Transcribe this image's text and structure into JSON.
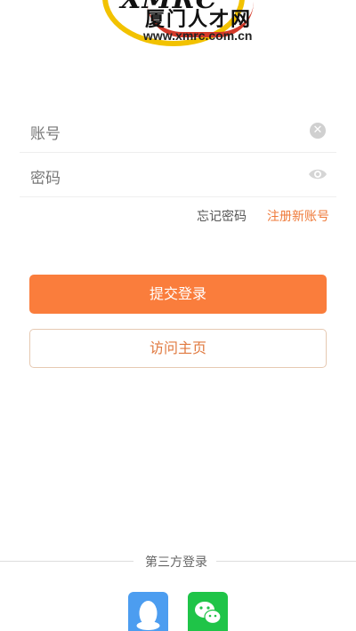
{
  "logo": {
    "brand": "XMRC",
    "name": "厦门人才网",
    "url": "www.xmrc.com.cn"
  },
  "form": {
    "account_label": "账号",
    "password_label": "密码",
    "account_value": "",
    "password_value": ""
  },
  "links": {
    "forgot_password": "忘记密码",
    "register": "注册新账号"
  },
  "buttons": {
    "login": "提交登录",
    "visit_home": "访问主页"
  },
  "third_party": {
    "label": "第三方登录",
    "providers": [
      {
        "name": "QQ",
        "icon": "qq-icon",
        "color": "#4c9df0"
      },
      {
        "name": "WeChat",
        "icon": "wechat-icon",
        "color": "#1fc448"
      }
    ]
  },
  "colors": {
    "accent": "#fa7d3c",
    "link_accent": "#ef7a3a"
  }
}
